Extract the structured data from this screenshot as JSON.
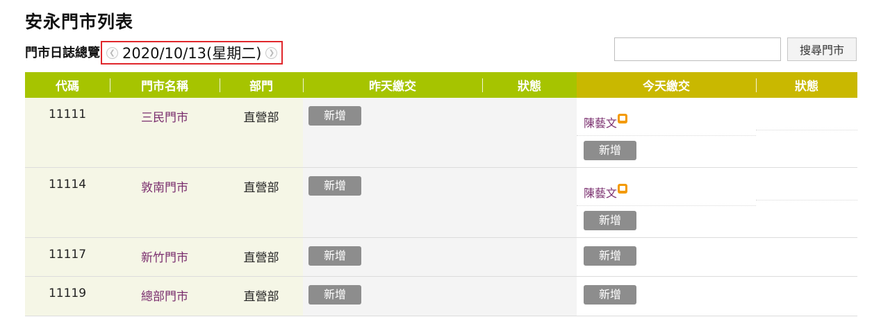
{
  "page": {
    "title": "安永門市列表"
  },
  "subheader": {
    "label": "門市日誌總覽",
    "date": "2020/10/13(星期二)",
    "prev_icon": "chevron-left-circle-icon",
    "next_icon": "chevron-right-circle-icon"
  },
  "search": {
    "value": "",
    "placeholder": "",
    "button_label": "搜尋門市"
  },
  "table": {
    "headers": {
      "code": "代碼",
      "name": "門市名稱",
      "dept": "部門",
      "yesterday": "昨天繳交",
      "yesterday_status": "狀態",
      "today": "今天繳交",
      "today_status": "狀態"
    },
    "rows": [
      {
        "code": "11111",
        "name": "三民門市",
        "dept": "直營部",
        "yesterday_button": "新增",
        "today_submitter": "陳藝文",
        "today_button": "新增"
      },
      {
        "code": "11114",
        "name": "敦南門市",
        "dept": "直營部",
        "yesterday_button": "新增",
        "today_submitter": "陳藝文",
        "today_button": "新增"
      },
      {
        "code": "11117",
        "name": "新竹門市",
        "dept": "直營部",
        "yesterday_button": "新增",
        "today_submitter": "",
        "today_button": "新增"
      },
      {
        "code": "11119",
        "name": "總部門市",
        "dept": "直營部",
        "yesterday_button": "新增",
        "today_submitter": "",
        "today_button": "新增"
      }
    ]
  },
  "colors": {
    "header_green": "#a6c400",
    "header_olive": "#c9b800",
    "date_highlight_border": "#e0262b",
    "store_link": "#7a2e6e",
    "submitter_icon": "#f39a00"
  }
}
